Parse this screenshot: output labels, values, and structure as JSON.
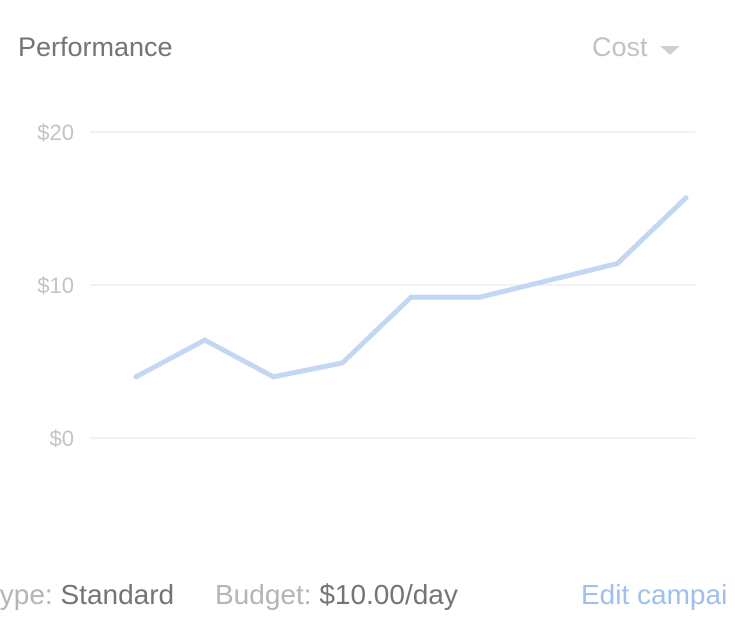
{
  "header": {
    "title": "Performance",
    "metric_selector": {
      "selected": "Cost",
      "icon": "dropdown-caret-icon"
    }
  },
  "chart_data": {
    "type": "line",
    "x": [
      1,
      2,
      3,
      4,
      5,
      6,
      7,
      8,
      9
    ],
    "series": [
      {
        "values": [
          4.0,
          6.4,
          4.0,
          4.9,
          9.2,
          9.2,
          10.3,
          11.4,
          15.7
        ]
      }
    ],
    "ylim": [
      0,
      20
    ],
    "yticks": [
      0,
      10,
      20
    ],
    "ytick_labels": [
      "$0",
      "$10",
      "$20"
    ],
    "grid": true,
    "line_color": "#c3d7f5",
    "grid_color": "#eeeeee",
    "tick_label_color": "#c4c4c4"
  },
  "footer": {
    "type_label": "type:",
    "type_value": "Standard",
    "budget_label": "Budget:",
    "budget_value": "$10.00/day",
    "edit_link": "Edit campai"
  },
  "colors": {
    "link": "#9fc0ee",
    "muted_text": "#b5b5b5",
    "value_text": "#757575"
  }
}
